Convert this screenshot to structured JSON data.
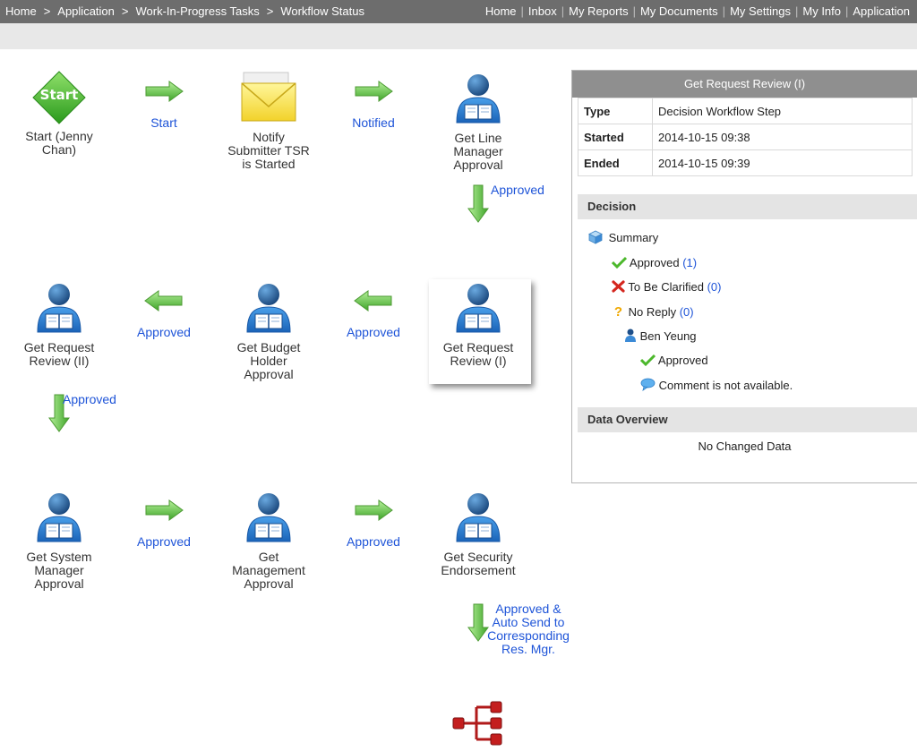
{
  "breadcrumb": [
    "Home",
    "Application",
    "Work-In-Progress Tasks",
    "Workflow Status"
  ],
  "top_nav": [
    "Home",
    "Inbox",
    "My Reports",
    "My Documents",
    "My Settings",
    "My Info",
    "Application"
  ],
  "start_icon_text": "Start",
  "nodes": {
    "start": "Start (Jenny Chan)",
    "notify": "Notify Submitter TSR is Started",
    "line_manager": "Get Line Manager Approval",
    "review_2": "Get Request Review (II)",
    "budget_holder": "Get Budget Holder Approval",
    "review_1": "Get Request Review (I)",
    "system_manager": "Get System Manager Approval",
    "management": "Get Management Approval",
    "security": "Get Security Endorsement"
  },
  "edges": {
    "start_to_notify": "Start",
    "notify_to_line": "Notified",
    "line_to_review1": "Approved",
    "review1_to_budget": "Approved",
    "budget_to_review2": "Approved",
    "review2_to_system": "Approved",
    "system_to_management": "Approved",
    "management_to_security": "Approved",
    "security_to_next": "Approved & Auto Send to Corresponding Res. Mgr."
  },
  "panel": {
    "title": "Get Request Review (I)",
    "fields": [
      {
        "label": "Type",
        "value": "Decision Workflow Step"
      },
      {
        "label": "Started",
        "value": "2014-10-15 09:38"
      },
      {
        "label": "Ended",
        "value": "2014-10-15 09:39"
      }
    ],
    "decision_header": "Decision",
    "summary_label": "Summary",
    "approved_label": "Approved",
    "approved_count": "(1)",
    "clarify_label": "To Be Clarified",
    "clarify_count": "(0)",
    "noreply_label": "No Reply",
    "noreply_count": "(0)",
    "reviewer_name": "Ben Yeung",
    "reviewer_decision": "Approved",
    "reviewer_comment": "Comment is not available.",
    "data_overview_header": "Data Overview",
    "data_overview_text": "No Changed Data"
  },
  "colors": {
    "link_blue": "#1e54d8",
    "arrow_green": "#5bbf3a",
    "person_blue": "#2a7fd4",
    "start_green": "#3fb52a",
    "topbar_gray": "#6d6d6d"
  }
}
